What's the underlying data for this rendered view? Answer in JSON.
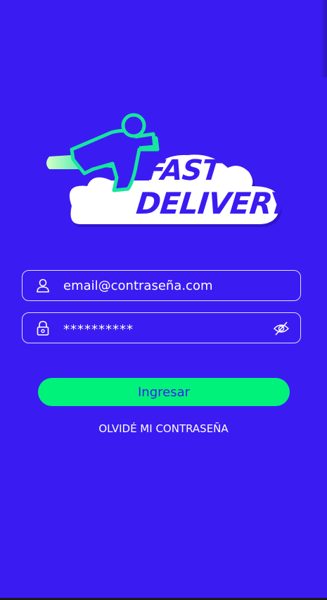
{
  "logo": {
    "line1": "FAST",
    "line2": "DELIVERY",
    "colors": {
      "cloud": "#ffffff",
      "runner": "#16e5a0",
      "text": "#3a1cf2"
    }
  },
  "login": {
    "email_value": "email@contraseña.com",
    "password_value": "**********",
    "submit_label": "Ingresar",
    "forgot_label": "OLVIDÉ MI CONTRASEÑA"
  },
  "icons": {
    "email": "user-icon",
    "password": "lock-icon",
    "visibility": "eye-off-icon"
  },
  "colors": {
    "background": "#3a1cf2",
    "accent": "#00f27a",
    "text": "#ffffff"
  }
}
